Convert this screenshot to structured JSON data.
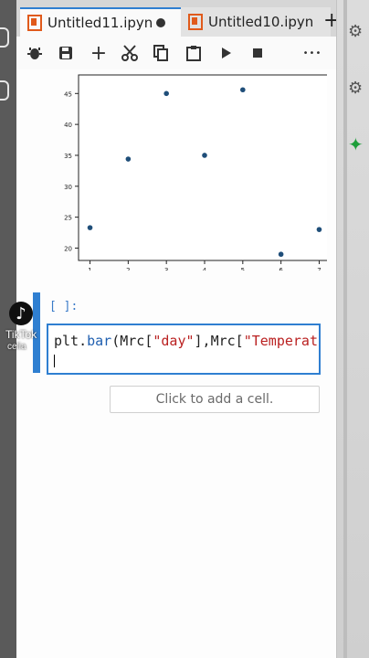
{
  "tabs": [
    {
      "label": "Untitled11.ipyn",
      "active": true,
      "dirty": true
    },
    {
      "label": "Untitled10.ipyn",
      "active": false,
      "dirty": false
    }
  ],
  "tab_plus": "+",
  "toolbar": {
    "icons": [
      "bug-icon",
      "save-icon",
      "add-cell-icon",
      "cut-icon",
      "copy-icon",
      "paste-icon",
      "run-icon",
      "stop-icon",
      "more-icon"
    ],
    "glyphs": {
      "add": "+",
      "more": "•••"
    }
  },
  "prompt": "[ ]:",
  "code": {
    "prefix": "plt.",
    "fn": "bar",
    "open": "(Mrc[",
    "str1": "\"day\"",
    "mid": "],Mrc[",
    "str2": "\"Temperat"
  },
  "add_cell_label": "Click to add a cell.",
  "tiktok": {
    "brand": "TikTok",
    "user": "celia"
  },
  "colors": {
    "accent": "#2f7fd1",
    "point": "#1f4e79"
  },
  "chart_data": {
    "type": "scatter",
    "x": [
      1,
      2,
      3,
      4,
      5,
      6,
      7
    ],
    "y": [
      23.3,
      34.4,
      45.0,
      35.0,
      45.6,
      19.0,
      23.0
    ],
    "xticks": [
      1,
      2,
      3,
      4,
      5,
      6,
      7
    ],
    "yticks": [
      20,
      25,
      30,
      35,
      40,
      45
    ],
    "xlim": [
      0.7,
      7.3
    ],
    "ylim": [
      18,
      48
    ],
    "grid": false
  }
}
